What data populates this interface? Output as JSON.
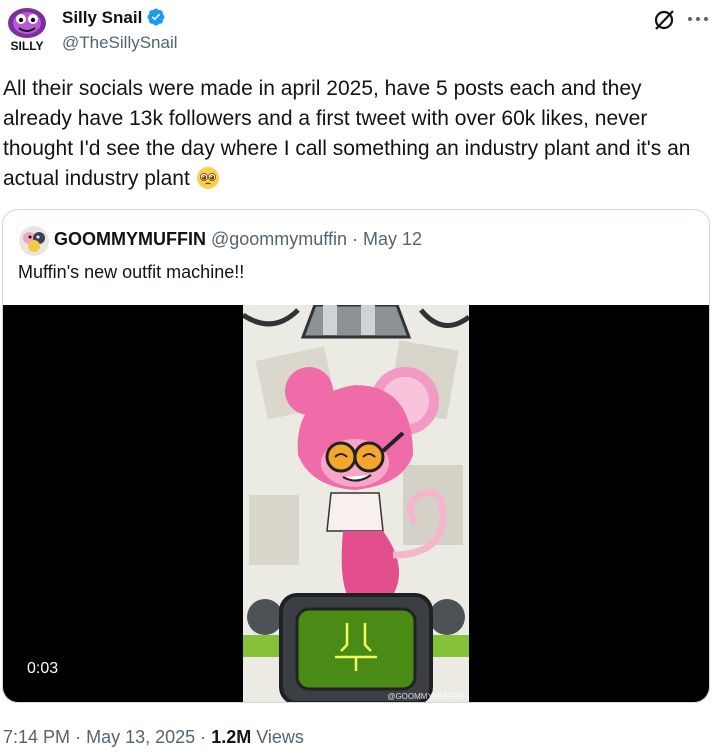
{
  "author": {
    "display_name": "Silly Snail",
    "handle": "@TheSillySnail",
    "avatar_text": "SILLY",
    "verified_icon": "verified-badge-icon",
    "brand_color": "#1d9bf0"
  },
  "tweet": {
    "text": "All their socials were made in april 2025, have 5 posts each and they already have 13k followers and a first tweet with over 60k likes, never thought I'd see the day where I call something an industry plant and it's an actual industry plant",
    "emoji": "pleading-face-emoji"
  },
  "quoted": {
    "display_name": "GOOMMYMUFFIN",
    "handle": "@goommymuffin",
    "separator": "·",
    "date": "May 12",
    "text": "Muffin's new outfit machine!!",
    "video": {
      "duration": "0:03",
      "watermark": "@GOOMMYMUFFIN"
    }
  },
  "footer": {
    "time": "7:14 PM",
    "sep1": "·",
    "date": "May 13, 2025",
    "sep2": "·",
    "views_count": "1.2M",
    "views_label": "Views"
  }
}
